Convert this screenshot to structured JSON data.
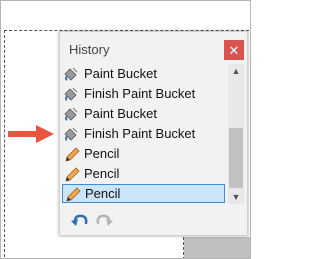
{
  "history_panel": {
    "title": "History",
    "close_icon": "close-icon",
    "items": [
      {
        "label": "Paint Bucket",
        "icon": "paint-bucket-icon",
        "selected": false
      },
      {
        "label": "Finish Paint Bucket",
        "icon": "paint-bucket-icon",
        "selected": false
      },
      {
        "label": "Paint Bucket",
        "icon": "paint-bucket-icon",
        "selected": false
      },
      {
        "label": "Finish Paint Bucket",
        "icon": "paint-bucket-icon",
        "selected": false
      },
      {
        "label": "Pencil",
        "icon": "pencil-icon",
        "selected": false
      },
      {
        "label": "Pencil",
        "icon": "pencil-icon",
        "selected": false
      },
      {
        "label": "Pencil",
        "icon": "pencil-icon",
        "selected": true
      }
    ],
    "undo_icon": "undo-icon",
    "redo_icon": "redo-icon"
  },
  "colors": {
    "close_button": "#d9534f",
    "selection_fill": "#cce4f7",
    "selection_border": "#3b8fd6",
    "arrow": "#e8553e",
    "undo": "#2f6fb5"
  }
}
